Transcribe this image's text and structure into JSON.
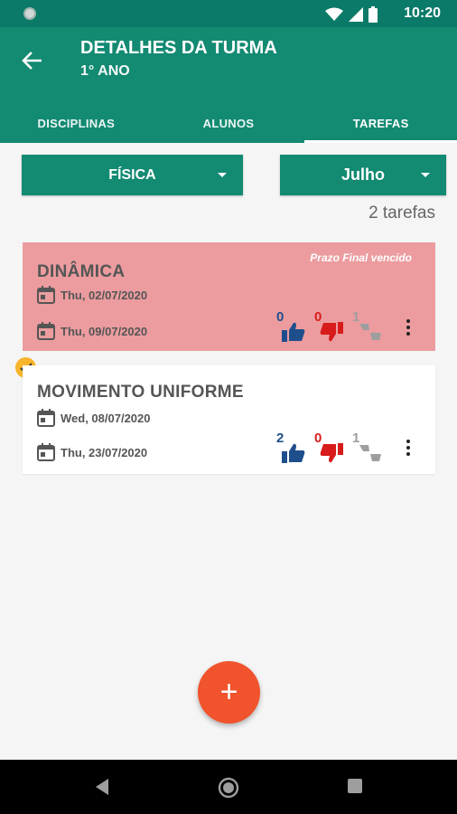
{
  "status_bar": {
    "time": "10:20"
  },
  "header": {
    "title": "DETALHES DA TURMA",
    "subtitle": "1° ANO"
  },
  "tabs": [
    {
      "label": "DISCIPLINAS",
      "active": false
    },
    {
      "label": "ALUNOS",
      "active": false
    },
    {
      "label": "TAREFAS",
      "active": true
    }
  ],
  "filters": {
    "subject": "FÍSICA",
    "month": "Julho"
  },
  "task_count": "2 tarefas",
  "tasks": [
    {
      "title": "DINÂMICA",
      "note": "Prazo Final vencido",
      "start_date": "Thu, 02/07/2020",
      "due_date": "Thu, 09/07/2020",
      "likes": "0",
      "dislikes": "0",
      "neutral": "1",
      "status": "overdue"
    },
    {
      "title": "MOVIMENTO UNIFORME",
      "start_date": "Wed, 08/07/2020",
      "due_date": "Thu, 23/07/2020",
      "likes": "2",
      "dislikes": "0",
      "neutral": "1",
      "status": "done"
    }
  ],
  "fab_label": "+",
  "colors": {
    "primary": "#138a72",
    "status_bar": "#0b7a68",
    "overdue_card": "#ec9c9f",
    "like": "#1f4e8c",
    "dislike": "#d81b1b",
    "neutral": "#9e9e9e",
    "fab": "#f1532c",
    "check_badge": "#f7b52c"
  },
  "icons": [
    "back-arrow-icon",
    "calendar-icon",
    "thumbs-up-icon",
    "thumbs-down-icon",
    "mixed-thumbs-icon",
    "more-vert-icon",
    "check-icon",
    "plus-icon"
  ]
}
